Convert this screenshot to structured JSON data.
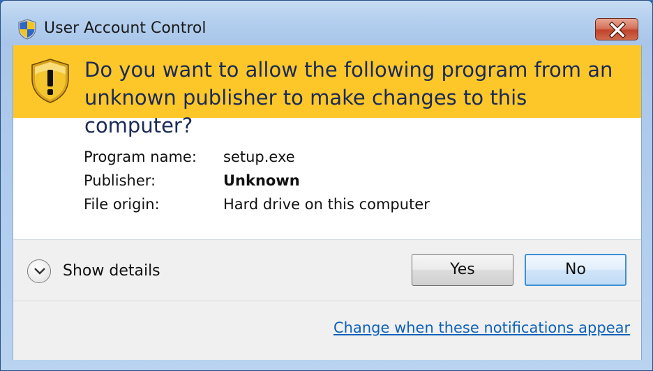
{
  "window": {
    "title": "User Account Control",
    "close_icon": "close-x-icon",
    "title_icon": "uac-shield-icon"
  },
  "banner": {
    "icon": "warning-shield-icon",
    "question": "Do you want to allow the following program from an unknown publisher to make changes to this computer?",
    "color": "#fdc72a"
  },
  "info": {
    "rows": [
      {
        "label": "Program name:",
        "value": "setup.exe"
      },
      {
        "label": "Publisher:",
        "value": "Unknown"
      },
      {
        "label": "File origin:",
        "value": "Hard drive on this computer"
      }
    ]
  },
  "footer": {
    "details_label": "Show details",
    "details_icon": "chevron-down-icon",
    "yes_label": "Yes",
    "no_label": "No",
    "link_text": "Change when these notifications appear",
    "link_color": "#0f62b8"
  }
}
